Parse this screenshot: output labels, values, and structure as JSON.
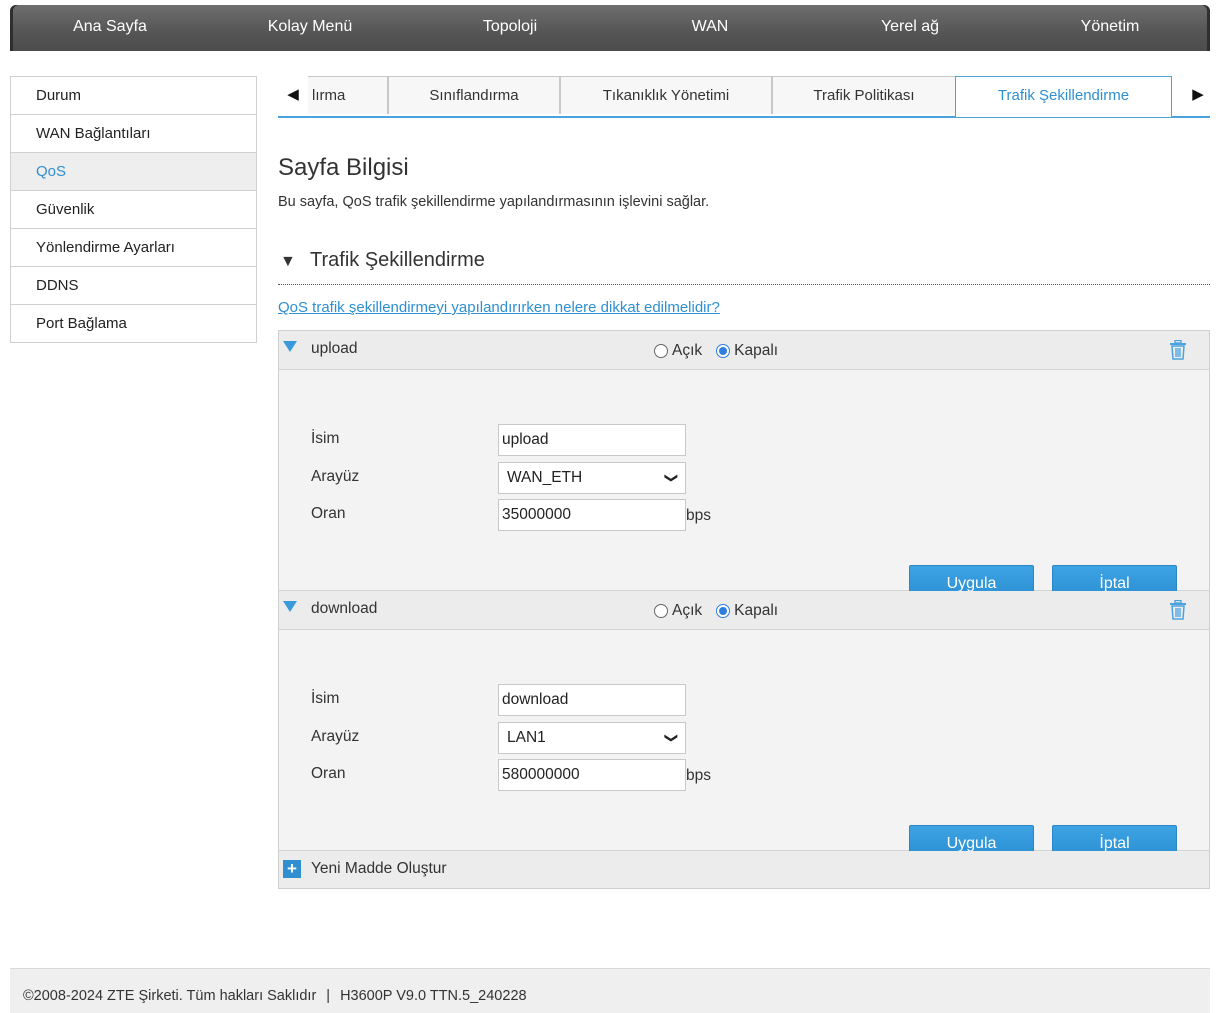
{
  "topnav": {
    "items": [
      "Ana Sayfa",
      "Kolay Menü",
      "Topoloji",
      "WAN",
      "Yerel ağ",
      "Yönetim"
    ]
  },
  "sidebar": {
    "items": [
      "Durum",
      "WAN Bağlantıları",
      "QoS",
      "Güvenlik",
      "Yönlendirme Ayarları",
      "DDNS",
      "Port Bağlama"
    ],
    "active": "QoS"
  },
  "tabs": {
    "prev_icon": "left-triangle-icon",
    "next_icon": "right-triangle-icon",
    "items": [
      "lırma",
      "Sınıflandırma",
      "Tıkanıklık Yönetimi",
      "Trafik Politikası",
      "Trafik Şekillendirme"
    ],
    "active": "Trafik Şekillendirme"
  },
  "page": {
    "title": "Sayfa Bilgisi",
    "description": "Bu sayfa, QoS trafik şekillendirme yapılandırmasının işlevini sağlar.",
    "section_title": "Trafik Şekillendirme",
    "help_link": "QoS trafik şekillendirmeyi yapılandırırken nelere dikkat edilmelidir?"
  },
  "labels": {
    "on": "Açık",
    "off": "Kapalı",
    "name": "İsim",
    "interface": "Arayüz",
    "rate": "Oran",
    "unit": "bps",
    "apply": "Uygula",
    "cancel": "İptal",
    "new_item": "Yeni Madde Oluştur"
  },
  "entries": [
    {
      "title": "upload",
      "state": "Kapalı",
      "name": "upload",
      "interface": "WAN_ETH",
      "rate": "35000000"
    },
    {
      "title": "download",
      "state": "Kapalı",
      "name": "download",
      "interface": "LAN1",
      "rate": "580000000"
    }
  ],
  "footer": {
    "copyright": "©2008-2024 ZTE Şirketi. Tüm hakları Saklıdır",
    "separator": "|",
    "version": "H3600P V9.0 TTN.5_240228"
  },
  "colors": {
    "accent": "#2f8fd0",
    "nav_bg": "#555555",
    "button": "#3399dd"
  }
}
